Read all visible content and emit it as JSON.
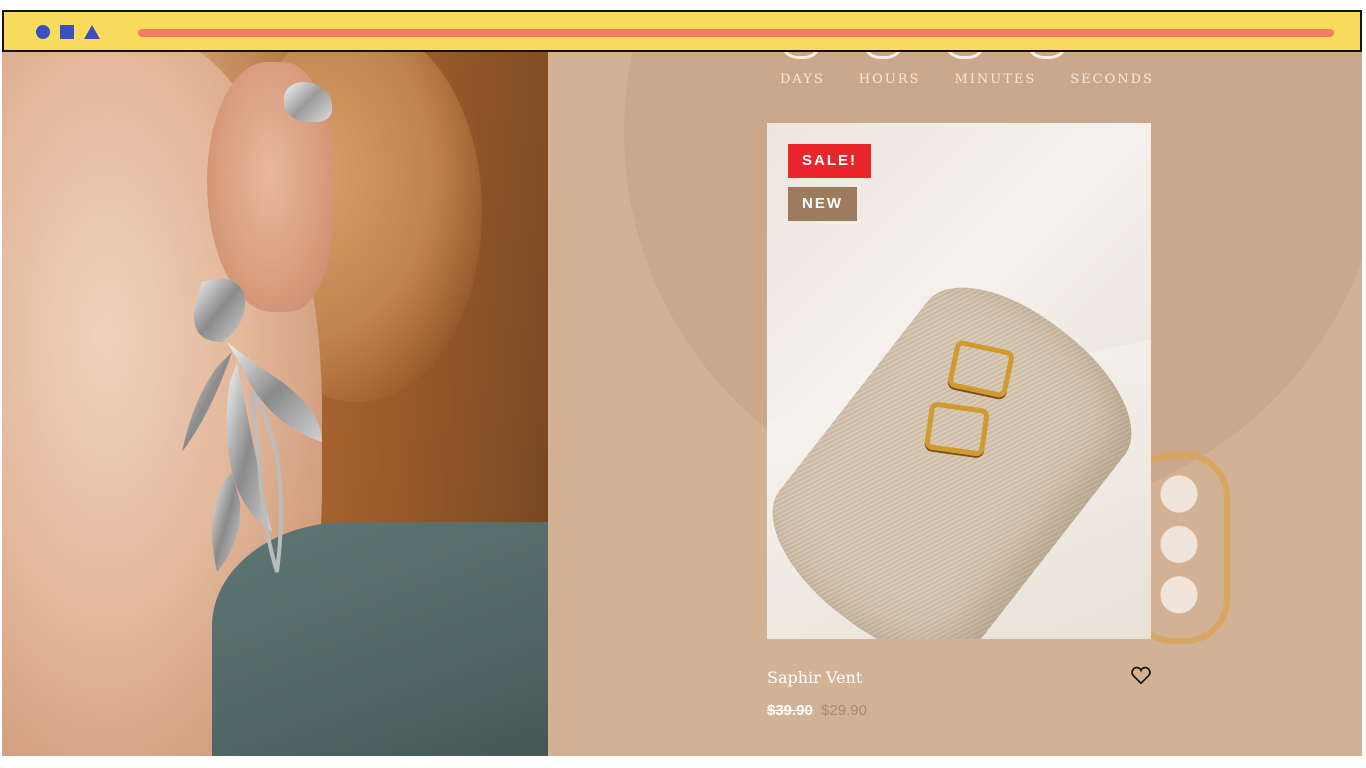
{
  "browser_bar": {
    "icons": [
      "circle-icon",
      "square-icon",
      "triangle-icon"
    ],
    "accent_color": "#3b4fc2",
    "bar_color": "#f9dc5c",
    "progress_color": "#f27b6a"
  },
  "countdown": {
    "labels": [
      "DAYS",
      "HOURS",
      "MINUTES",
      "SECONDS"
    ]
  },
  "product": {
    "badges": {
      "sale": "SALE!",
      "new": "NEW"
    },
    "name": "Saphir Vent",
    "price_old": "$39.90",
    "price_new": "$29.90",
    "wishlist_icon": "heart-icon"
  },
  "colors": {
    "sale_badge": "#e8252a",
    "new_badge": "#9c7b5e",
    "panel_bg": "#d3b195"
  }
}
